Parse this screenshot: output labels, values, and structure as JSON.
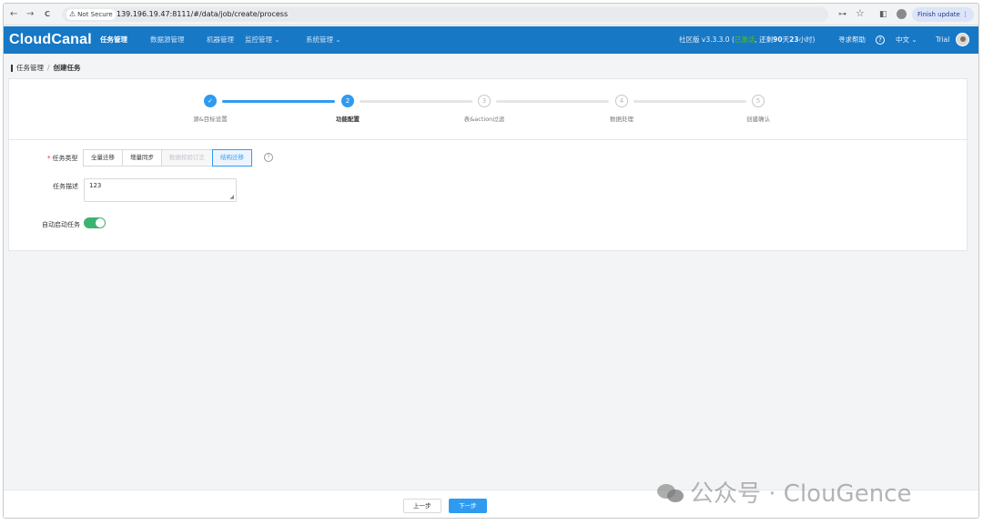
{
  "browser": {
    "back_icon": "arrow-left-icon",
    "back": "←",
    "forward": "→",
    "reload": "C",
    "security_label": "Not Secure",
    "warning_glyph": "⚠",
    "url": "139.196.19.47:8111/#/data/job/create/process",
    "key_icon": "⊶",
    "star_icon": "☆",
    "sidebar_icon": "◧",
    "finish_update_label": "Finish update",
    "menu_dots": "⋮"
  },
  "header": {
    "logo": "CloudCanal",
    "nav": [
      {
        "label": "任务管理",
        "active": true
      },
      {
        "label": "数据源管理",
        "active": false
      },
      {
        "label": "机器管理",
        "active": false
      },
      {
        "label": "监控管理 ⌄",
        "active": false
      },
      {
        "label": "系统管理 ⌄",
        "active": false
      }
    ],
    "edition": "社区版 v3.3.3.0",
    "paren_open": "(",
    "activated": "已激活",
    "remaining_prefix": ", 还剩",
    "remaining_days": "90",
    "remaining_day_unit": "天",
    "remaining_hours": "23",
    "remaining_suffix": "小时)",
    "help_label": "寻求帮助",
    "help_glyph": "?",
    "language": "中文 ⌄",
    "user": "Trial"
  },
  "breadcrumb": {
    "parent": "任务管理",
    "separator": "/",
    "current": "创建任务"
  },
  "steps": [
    {
      "index": "✓",
      "label": "源&目标设置",
      "status": "done"
    },
    {
      "index": "2",
      "label": "功能配置",
      "status": "current"
    },
    {
      "index": "3",
      "label": "表&action过滤",
      "status": "todo"
    },
    {
      "index": "4",
      "label": "数据处理",
      "status": "todo"
    },
    {
      "index": "5",
      "label": "创建确认",
      "status": "todo"
    }
  ],
  "form": {
    "task_type_required": "*",
    "task_type_label": "任务类型",
    "task_type_options": [
      {
        "label": "全量迁移",
        "state": "normal"
      },
      {
        "label": "增量同步",
        "state": "normal"
      },
      {
        "label": "数据校验订正",
        "state": "disabled"
      },
      {
        "label": "结构迁移",
        "state": "selected"
      }
    ],
    "task_type_help_glyph": "?",
    "desc_label": "任务描述",
    "desc_value": "123",
    "resize_glyph": "◢",
    "auto_start_label": "自动启动任务",
    "auto_start_enabled": true
  },
  "footer": {
    "prev_label": "上一步",
    "next_label": "下一步"
  },
  "watermark": {
    "text": "公众号 · ClouGence"
  },
  "colors": {
    "header_bg": "#1778c6",
    "primary": "#2f9bf0",
    "toggle_on": "#3cb371",
    "activated_text": "#52c41a"
  }
}
